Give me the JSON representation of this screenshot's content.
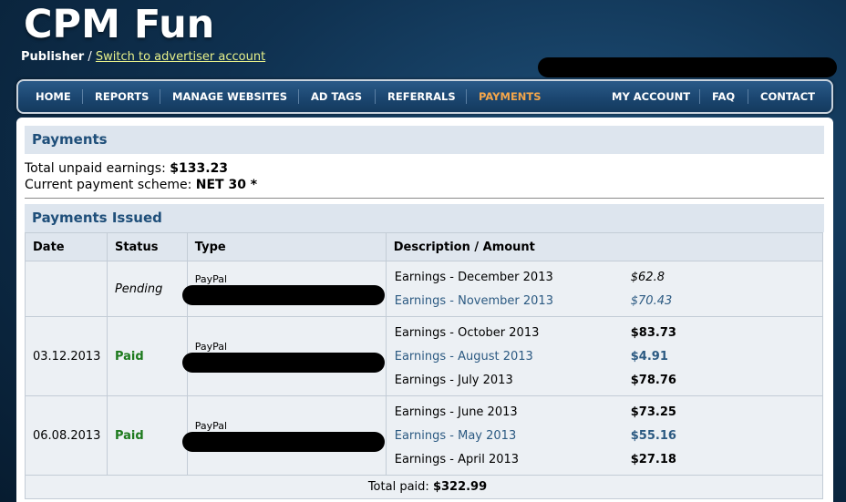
{
  "site": {
    "logo": "CPM Fun",
    "role": "Publisher",
    "separator": " / ",
    "switch_link": "Switch to advertiser account"
  },
  "nav": {
    "left": [
      "HOME",
      "REPORTS",
      "MANAGE WEBSITES",
      "AD TAGS",
      "REFERRALS",
      "PAYMENTS"
    ],
    "right": [
      "MY ACCOUNT",
      "FAQ",
      "CONTACT"
    ],
    "active": "PAYMENTS"
  },
  "payments": {
    "heading": "Payments",
    "unpaid_label": "Total unpaid earnings:",
    "unpaid_value": "$133.23",
    "scheme_label": "Current payment scheme:",
    "scheme_value": "NET 30 *"
  },
  "issued": {
    "heading": "Payments Issued",
    "columns": [
      "Date",
      "Status",
      "Type",
      "Description / Amount"
    ],
    "rows": [
      {
        "date": "",
        "status": "Pending",
        "type": "PayPal",
        "items": [
          {
            "label": "Earnings - December 2013",
            "amount": "$62.8"
          },
          {
            "label": "Earnings - November 2013",
            "amount": "$70.43"
          }
        ]
      },
      {
        "date": "03.12.2013",
        "status": "Paid",
        "type": "PayPal",
        "items": [
          {
            "label": "Earnings - October 2013",
            "amount": "$83.73"
          },
          {
            "label": "Earnings - August 2013",
            "amount": "$4.91"
          },
          {
            "label": "Earnings - July 2013",
            "amount": "$78.76"
          }
        ]
      },
      {
        "date": "06.08.2013",
        "status": "Paid",
        "type": "PayPal",
        "items": [
          {
            "label": "Earnings - June 2013",
            "amount": "$73.25"
          },
          {
            "label": "Earnings - May 2013",
            "amount": "$55.16"
          },
          {
            "label": "Earnings - April 2013",
            "amount": "$27.18"
          }
        ]
      }
    ],
    "total_label": "Total paid:",
    "total_value": "$322.99"
  },
  "colors": {
    "accent": "#f4a64a",
    "link": "#2c5a82",
    "paid": "#1d7a1d",
    "heading": "#1f4f7a"
  }
}
